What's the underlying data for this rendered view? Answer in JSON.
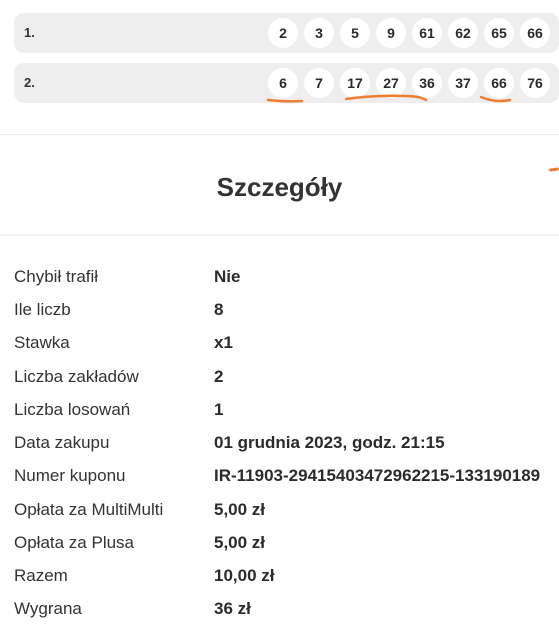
{
  "bets": [
    {
      "index": "1.",
      "numbers": [
        "2",
        "3",
        "5",
        "9",
        "61",
        "62",
        "65",
        "66"
      ]
    },
    {
      "index": "2.",
      "numbers": [
        "6",
        "7",
        "17",
        "27",
        "36",
        "37",
        "66",
        "76"
      ]
    }
  ],
  "annotation_color": "#ee7d32",
  "details": {
    "title": "Szczegóły",
    "rows": [
      {
        "label": "Chybił trafił",
        "value": "Nie"
      },
      {
        "label": "Ile liczb",
        "value": "8"
      },
      {
        "label": "Stawka",
        "value": "x1"
      },
      {
        "label": "Liczba zakładów",
        "value": "2"
      },
      {
        "label": "Liczba losowań",
        "value": "1"
      },
      {
        "label": "Data zakupu",
        "value": "01 grudnia 2023, godz. 21:15"
      },
      {
        "label": "Numer kuponu",
        "value": "IR-11903-29415403472962215-133190189"
      },
      {
        "label": "Opłata za MultiMulti",
        "value": "5,00 zł"
      },
      {
        "label": "Opłata za Plusa",
        "value": "5,00 zł"
      },
      {
        "label": "Razem",
        "value": "10,00 zł"
      },
      {
        "label": "Wygrana",
        "value": "36 zł"
      }
    ]
  }
}
